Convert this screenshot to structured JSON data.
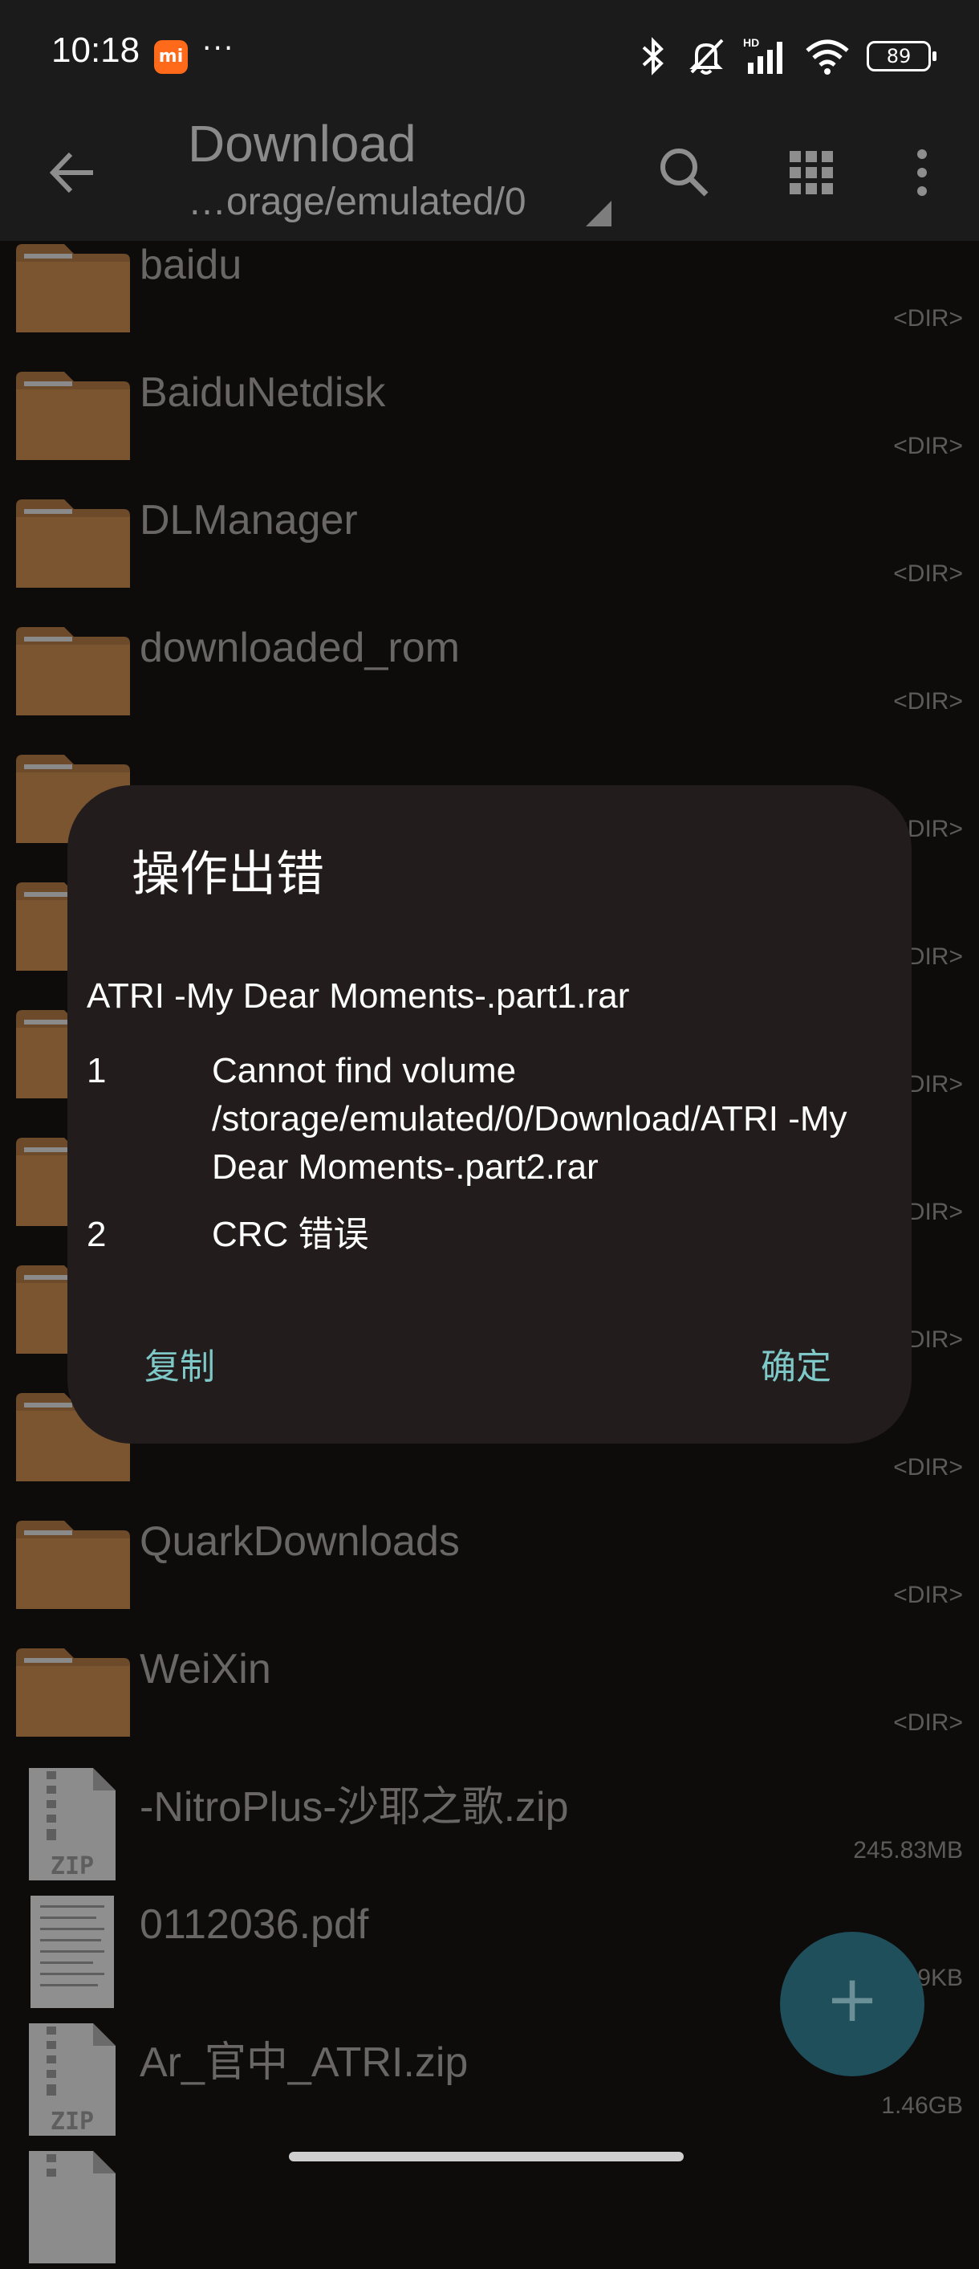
{
  "status_bar": {
    "time": "10:18",
    "mi_badge": "mi",
    "more": "···",
    "battery": "89"
  },
  "toolbar": {
    "title": "Download",
    "path": "…orage/emulated/0"
  },
  "colors": {
    "folder": "#7a5530",
    "accent": "#7ec8c8",
    "dialog_bg": "#221c1c"
  },
  "files": [
    {
      "name": "baidu",
      "meta": "<DIR>",
      "type": "folder"
    },
    {
      "name": "BaiduNetdisk",
      "meta": "<DIR>",
      "type": "folder"
    },
    {
      "name": "DLManager",
      "meta": "<DIR>",
      "type": "folder"
    },
    {
      "name": "downloaded_rom",
      "meta": "<DIR>",
      "type": "folder"
    },
    {
      "name": "QuarkDownloads",
      "meta": "<DIR>",
      "type": "folder"
    },
    {
      "name": "WeiXin",
      "meta": "<DIR>",
      "type": "folder"
    },
    {
      "name": "-NitroPlus-沙耶之歌.zip",
      "meta": "245.83MB",
      "type": "zip"
    },
    {
      "name": "0112036.pdf",
      "meta": "9KB",
      "type": "pdf"
    },
    {
      "name": "Ar_官中_ATRI.zip",
      "meta": "1.46GB",
      "type": "zip"
    }
  ],
  "dir_label": "<DIR>",
  "dialog": {
    "title": "操作出错",
    "file": "ATRI -My Dear Moments-.part1.rar",
    "errors": [
      {
        "num": "1",
        "msg": "Cannot find volume /storage/emulated/0/Download/ATRI -My Dear Moments-.part2.rar"
      },
      {
        "num": "2",
        "msg": "CRC 错误"
      }
    ],
    "copy_label": "复制",
    "ok_label": "确定"
  }
}
